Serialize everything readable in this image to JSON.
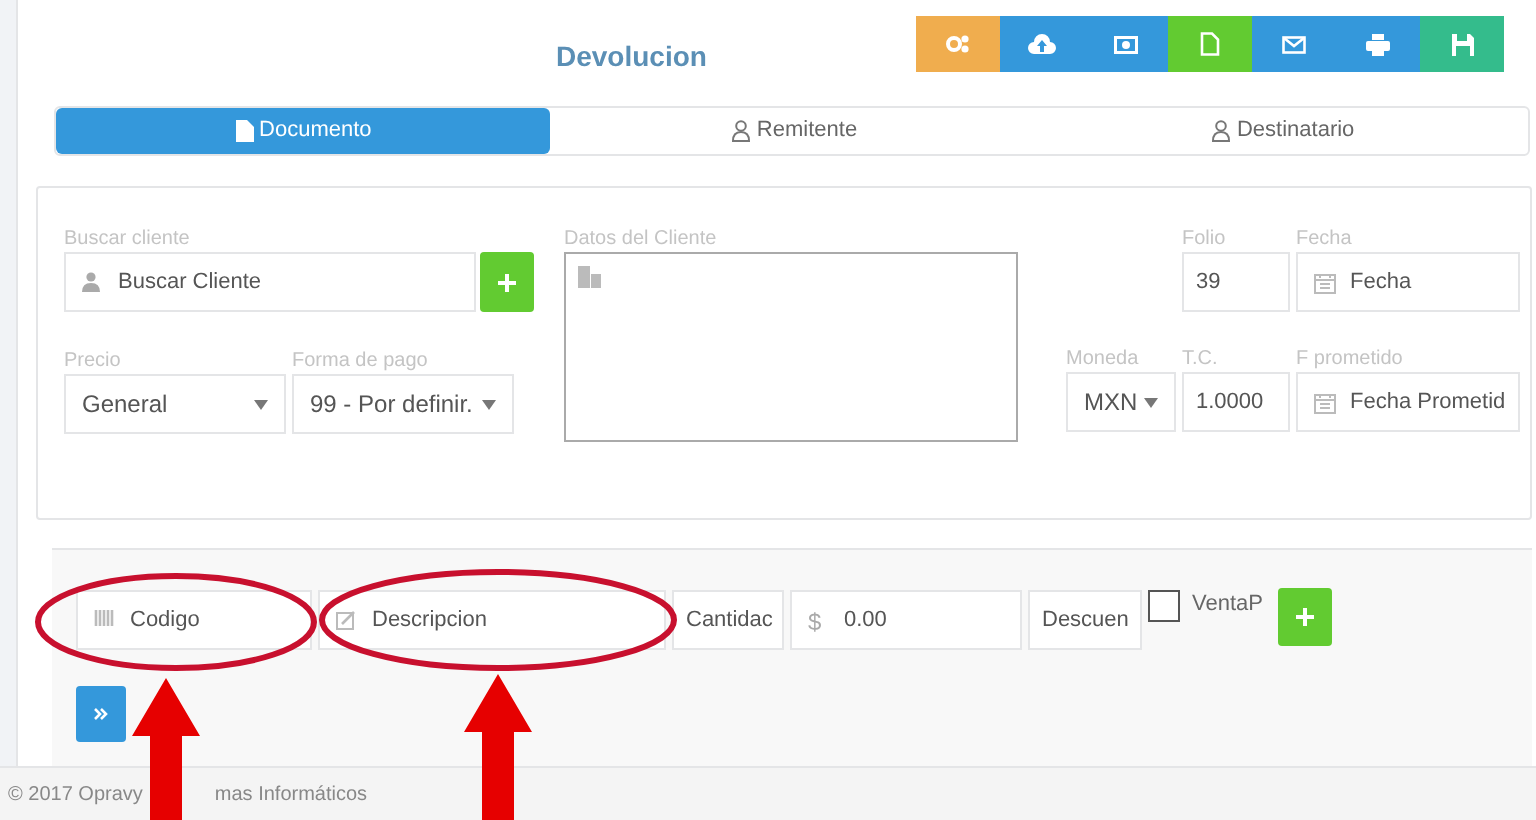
{
  "title": "Devolucion",
  "toolbar": [
    {
      "kind": "gears",
      "color": "#f0ad4e"
    },
    {
      "kind": "cloud",
      "color": "#3498db"
    },
    {
      "kind": "money",
      "color": "#3498db"
    },
    {
      "kind": "file",
      "color": "#62cb31"
    },
    {
      "kind": "mail",
      "color": "#3498db"
    },
    {
      "kind": "print",
      "color": "#3498db"
    },
    {
      "kind": "save",
      "color": "#34bc8c"
    }
  ],
  "tabs": [
    {
      "label": "Documento",
      "kind": "file",
      "selected": true
    },
    {
      "label": "Remitente",
      "kind": "user",
      "selected": false
    },
    {
      "label": "Destinatario",
      "kind": "user",
      "selected": false
    }
  ],
  "customer": {
    "search_label": "Buscar cliente",
    "search_placeholder": "Buscar Cliente",
    "details_label": "Datos del Cliente"
  },
  "precio": {
    "label": "Precio",
    "value": "General"
  },
  "forma_pago": {
    "label": "Forma de pago",
    "value": "99 - Por definir."
  },
  "folio": {
    "label": "Folio",
    "value": "39"
  },
  "fecha": {
    "label": "Fecha",
    "placeholder": "Fecha"
  },
  "moneda": {
    "label": "Moneda",
    "value": "MXN"
  },
  "tipo_cambio": {
    "label": "T.C.",
    "value": "1.0000"
  },
  "f_prometido": {
    "label": "F prometido",
    "placeholder": "Fecha Prometid"
  },
  "item_entry": {
    "codigo_placeholder": "Codigo",
    "descripcion_placeholder": "Descripcion",
    "cantidad_placeholder": "Cantidac",
    "currency": "$",
    "precio_placeholder": "0.00",
    "descuento_placeholder": "Descuen",
    "venta_label": "VentaP",
    "venta_checked": false
  },
  "footer": [
    "© 2017 Opravy",
    "mas Informáticos"
  ]
}
